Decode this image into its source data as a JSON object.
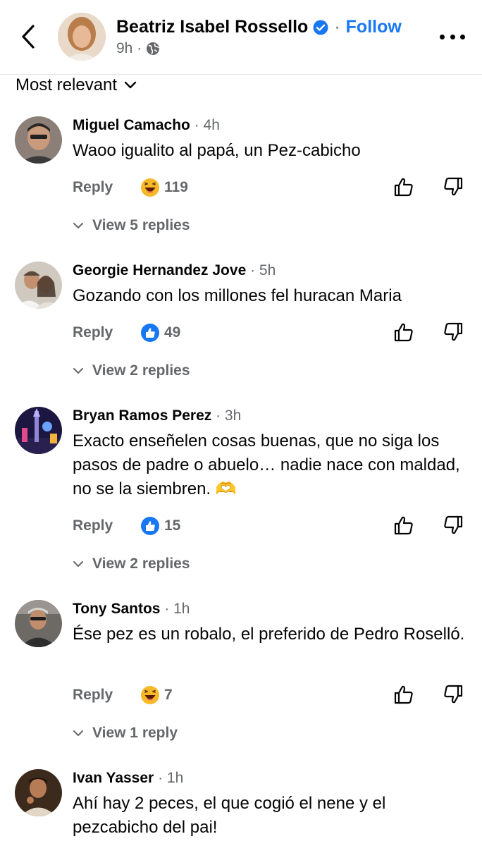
{
  "header": {
    "author": "Beatriz Isabel Rossello",
    "separator": "·",
    "follow": "Follow",
    "time": "9h ·",
    "icons": [
      "back-icon",
      "verified-icon",
      "globe-icon",
      "more-icon"
    ]
  },
  "sort": {
    "label": "Most relevant"
  },
  "comments": [
    {
      "name": "Miguel Camacho",
      "time": "· 4h",
      "text": "Waoo igualito al papá, un Pez-cabicho",
      "reply": "Reply",
      "reaction": "haha",
      "count": "119",
      "view_replies": "View 5 replies"
    },
    {
      "name": "Georgie Hernandez Jove",
      "time": "· 5h",
      "text": "Gozando con los millones fel huracan Maria",
      "reply": "Reply",
      "reaction": "like",
      "count": "49",
      "view_replies": "View 2 replies"
    },
    {
      "name": "Bryan Ramos Perez",
      "time": "· 3h",
      "text": "Exacto enseñelen cosas buenas, que no siga los pasos de padre o abuelo… nadie nace con maldad, no se la siembren. 🫶",
      "reply": "Reply",
      "reaction": "like",
      "count": "15",
      "view_replies": "View 2 replies"
    },
    {
      "name": "Tony Santos",
      "time": "· 1h",
      "text": "Ése pez es un robalo, el preferido de Pedro Roselló.",
      "reply": "Reply",
      "reaction": "haha",
      "count": "7",
      "view_replies": "View 1 reply"
    },
    {
      "name": "Ivan Yasser",
      "time": "· 1h",
      "text": "Ahí hay 2 peces, el que cogió el nene y el pezcabicho del pai!"
    }
  ],
  "colors": {
    "link": "#1877f2",
    "muted": "#65676b",
    "text": "#050505"
  }
}
